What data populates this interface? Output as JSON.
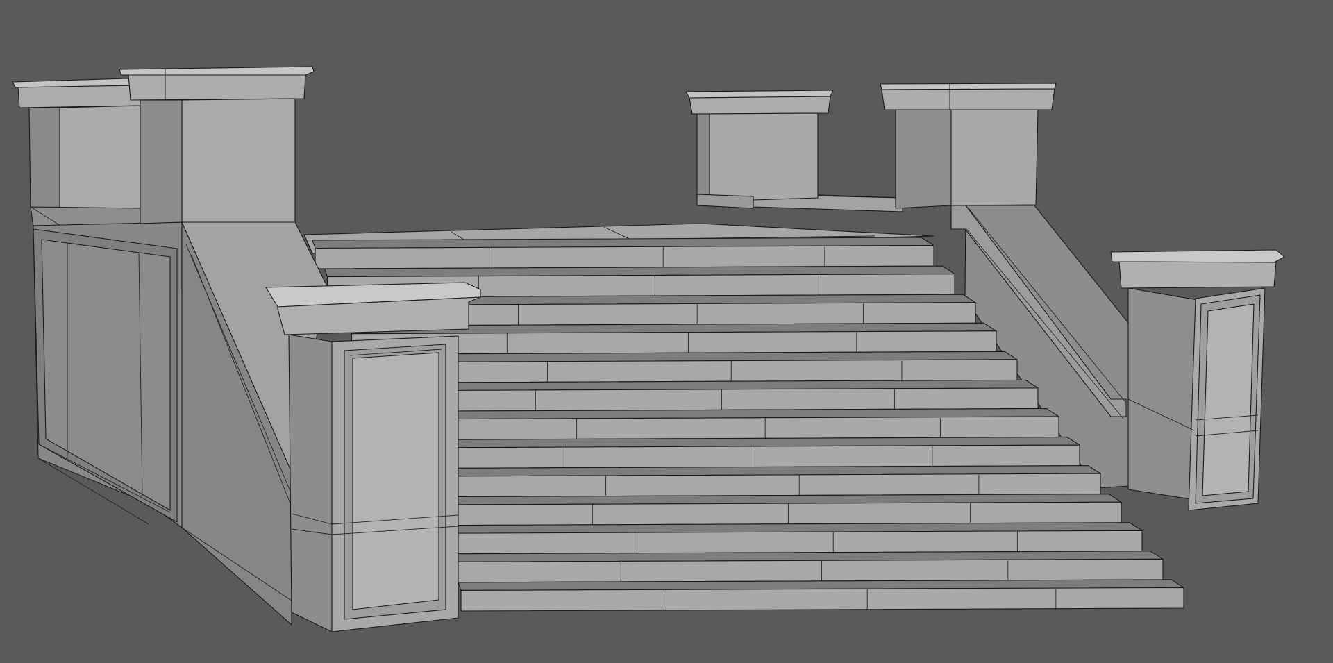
{
  "scene": {
    "subject": "stone-staircase-wireframe",
    "background_color": "#5a5a5a",
    "shades": {
      "top_light": "#bdbdbd",
      "front_face": "#a9a9a9",
      "front_mid": "#9c9c9c",
      "side_face": "#888888",
      "side_dark": "#7d7d7d",
      "wire_color": "#1a1a1a"
    },
    "step_count": 13
  }
}
